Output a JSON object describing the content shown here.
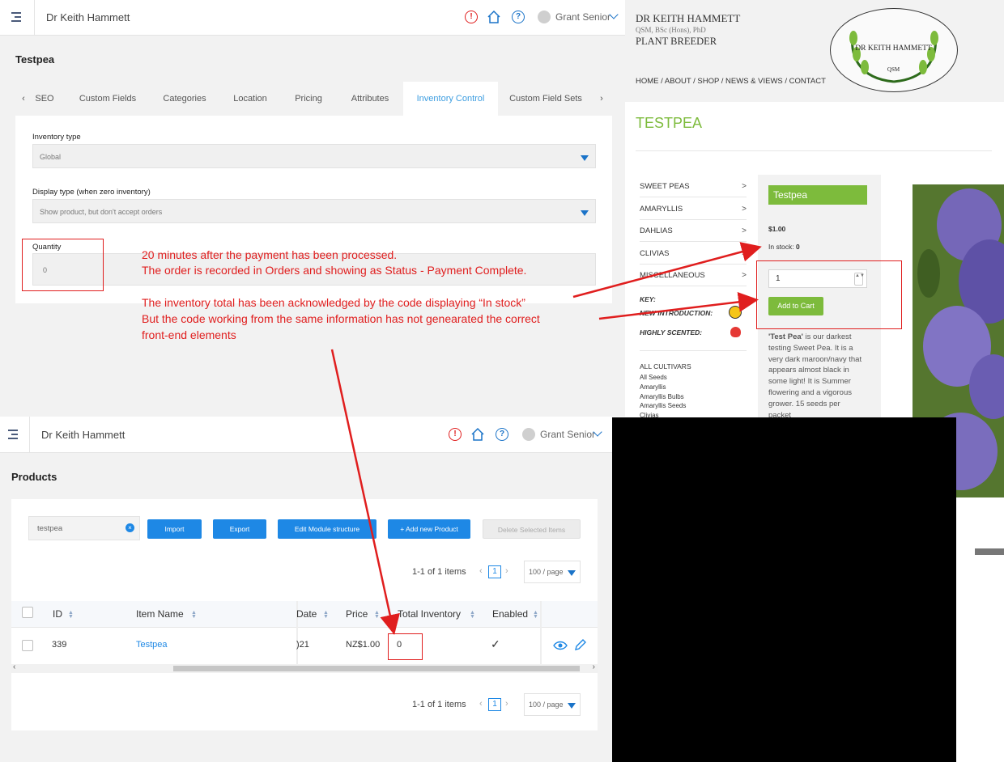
{
  "admin_top": {
    "brand": "Dr Keith Hammett",
    "user": "Grant Senior",
    "page_title": "Testpea",
    "tabs": [
      "SEO",
      "Custom Fields",
      "Categories",
      "Location",
      "Pricing",
      "Attributes",
      "Inventory Control",
      "Custom Field Sets"
    ],
    "active_tab": "Inventory Control",
    "tab_prev": "‹",
    "tab_next": "›",
    "inventory_type_label": "Inventory type",
    "inventory_type_value": "Global",
    "display_type_label": "Display type (when zero inventory)",
    "display_type_value": "Show product, but don't accept orders",
    "quantity_label": "Quantity",
    "quantity_value": "0"
  },
  "annotation": {
    "line1": "20 minutes after the payment has been processed.",
    "line2": "The order is  recorded in Orders and showing as Status - Payment  Complete.",
    "line3": "The inventory total has been acknowledged by the code displaying “In stock”",
    "line4": "But the code working from the same information has not genearated the correct",
    "line5": "front-end elements",
    "color": "#e01e1e"
  },
  "shop": {
    "name": "DR KEITH HAMMETT",
    "quals": "QSM, BSc (Hons), PhD",
    "role": "PLANT BREEDER",
    "logo_text": "DR KEITH HAMMETT",
    "logo_sub": "QSM",
    "nav": "HOME / ABOUT / SHOP / NEWS & VIEWS / CONTACT",
    "title": "TESTPEA",
    "menu": [
      "SWEET PEAS",
      "AMARYLLIS",
      "DAHLIAS",
      "CLIVIAS",
      "MISCELLANEOUS"
    ],
    "menu_arrow": ">",
    "key_label": "KEY:",
    "new_intro": "NEW INTRODUCTION:",
    "highly_scented": "HIGHLY SCENTED:",
    "all_cultivars": "ALL CULTIVARS",
    "cultivars": [
      "All Seeds",
      "Amaryllis",
      "Amaryllis Bulbs",
      "Amaryllis Seeds",
      "Clivias"
    ],
    "product_name": "Testpea",
    "price": "$1.00",
    "in_stock_label": "In stock:",
    "in_stock_value": "0",
    "qty_value": "1",
    "add_to_cart": "Add to Cart",
    "desc_bold": "'Test Pea'",
    "desc_lines": [
      " is our darkest",
      "testing Sweet Pea. It is a",
      "very dark maroon/navy that",
      "appears almost black in",
      "some light! It is Summer",
      "flowering and a vigorous",
      "grower. 15 seeds per",
      "packet"
    ],
    "accent_green": "#7dbb3c"
  },
  "products": {
    "brand": "Dr Keith Hammett",
    "user": "Grant Senior",
    "page_title": "Products",
    "search_value": "testpea",
    "buttons": {
      "import": "Import",
      "export": "Export",
      "edit_module": "Edit Module structure",
      "add_new": "+ Add new Product",
      "delete_selected": "Delete Selected Items"
    },
    "pager_text": "1-1 of 1 items",
    "page_num": "1",
    "per_page": "100 / page",
    "columns": [
      "ID",
      "Item Name",
      "Date",
      "Price",
      "Total Inventory",
      "Enabled"
    ],
    "row": {
      "id": "339",
      "name": "Testpea",
      "date": ")21",
      "price": "NZ$1.00",
      "inventory": "0",
      "enabled": "✓"
    },
    "scroll_left": "‹",
    "scroll_right": "›",
    "accent_blue": "#1e88e5"
  }
}
